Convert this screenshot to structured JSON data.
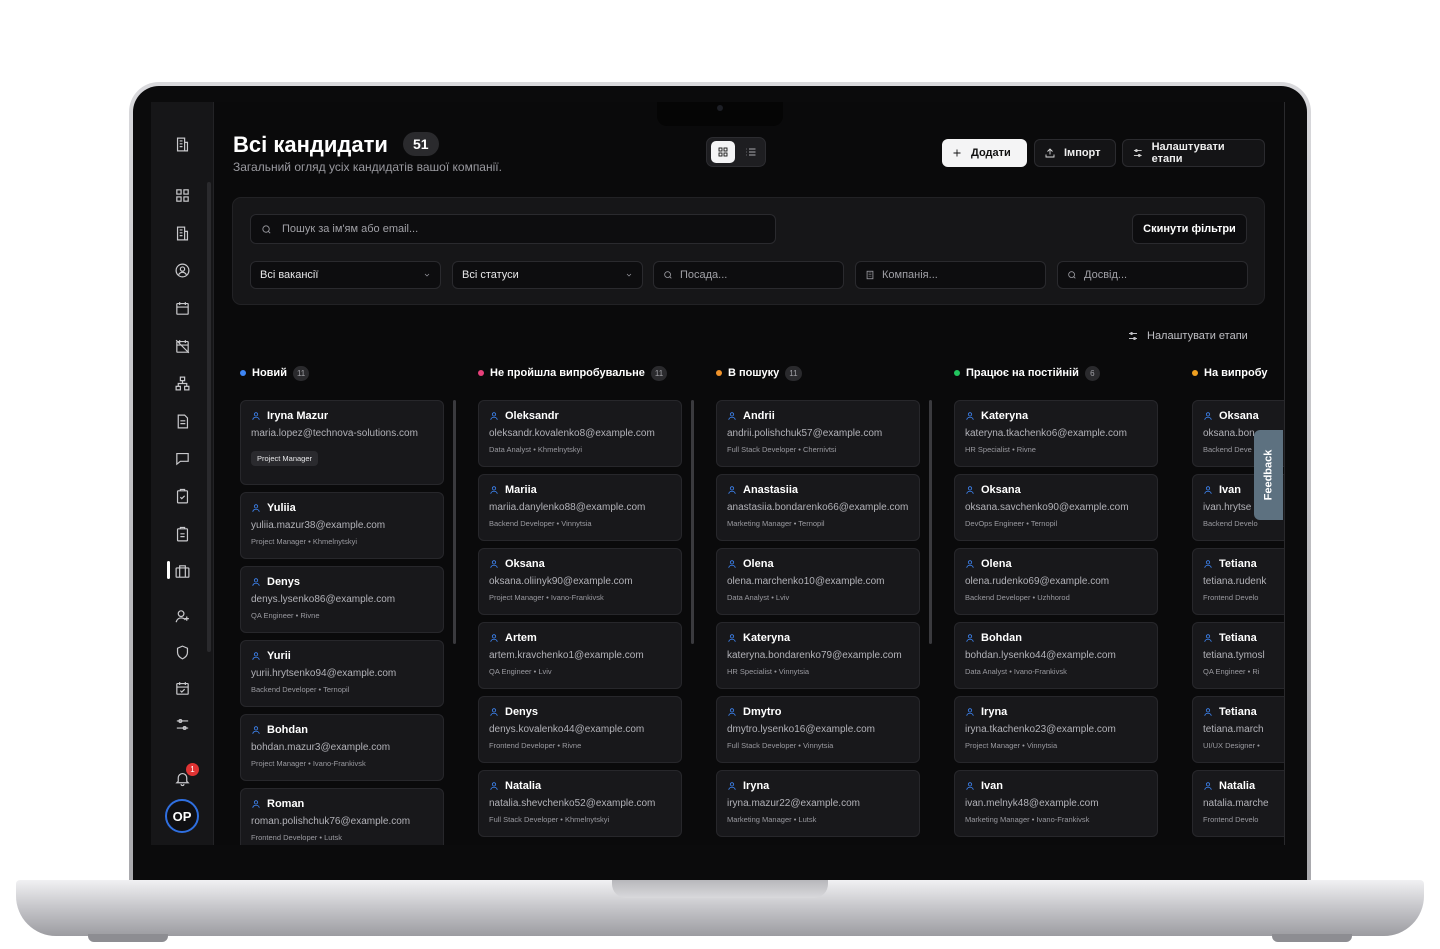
{
  "page": {
    "title": "Всі кандидати",
    "count": "51",
    "subtitle": "Загальний огляд усіх кандидатів вашої компанії."
  },
  "header_buttons": {
    "add": "Додати",
    "import": "Імпорт",
    "stages": "Налаштувати етапи"
  },
  "filters": {
    "search_placeholder": "Пошук за ім'ям або email...",
    "reset": "Скинути фільтри",
    "vacancies": "Всі вакансії",
    "statuses": "Всі статуси",
    "position_placeholder": "Посада...",
    "company_placeholder": "Компанія...",
    "experience_placeholder": "Досвід..."
  },
  "stages_link": "Налаштувати етапи",
  "notifications": {
    "badge": "1"
  },
  "user": {
    "initials": "OP"
  },
  "feedback": "Feedback",
  "colors": {
    "new": "#3e86f5",
    "failed": "#e8407a",
    "searching": "#f0932b",
    "employed": "#22c55e",
    "trial": "#f0a020"
  },
  "columns": [
    {
      "title": "Новий",
      "count": "11",
      "cards": [
        {
          "name": "Iryna Mazur",
          "email": "maria.lopez@technova-solutions.com",
          "tag": "Project Manager"
        },
        {
          "name": "Yuliia",
          "email": "yuliia.mazur38@example.com",
          "meta": "Project Manager • Khmelnytskyi"
        },
        {
          "name": "Denys",
          "email": "denys.lysenko86@example.com",
          "meta": "QA Engineer • Rivne"
        },
        {
          "name": "Yurii",
          "email": "yurii.hrytsenko94@example.com",
          "meta": "Backend Developer • Ternopil"
        },
        {
          "name": "Bohdan",
          "email": "bohdan.mazur3@example.com",
          "meta": "Project Manager • Ivano-Frankivsk"
        },
        {
          "name": "Roman",
          "email": "roman.polishchuk76@example.com",
          "meta": "Frontend Developer • Lutsk"
        }
      ]
    },
    {
      "title": "Не пройшла випробувальне",
      "count": "11",
      "cards": [
        {
          "name": "Oleksandr",
          "email": "oleksandr.kovalenko8@example.com",
          "meta": "Data Analyst • Khmelnytskyi"
        },
        {
          "name": "Mariia",
          "email": "mariia.danylenko88@example.com",
          "meta": "Backend Developer • Vinnytsia"
        },
        {
          "name": "Oksana",
          "email": "oksana.oliinyk90@example.com",
          "meta": "Project Manager • Ivano-Frankivsk"
        },
        {
          "name": "Artem",
          "email": "artem.kravchenko1@example.com",
          "meta": "QA Engineer • Lviv"
        },
        {
          "name": "Denys",
          "email": "denys.kovalenko44@example.com",
          "meta": "Frontend Developer • Rivne"
        },
        {
          "name": "Natalia",
          "email": "natalia.shevchenko52@example.com",
          "meta": "Full Stack Developer • Khmelnytskyi"
        }
      ]
    },
    {
      "title": "В пошуку",
      "count": "11",
      "cards": [
        {
          "name": "Andrii",
          "email": "andrii.polishchuk57@example.com",
          "meta": "Full Stack Developer • Chernivtsi"
        },
        {
          "name": "Anastasiia",
          "email": "anastasiia.bondarenko66@example.com",
          "meta": "Marketing Manager • Ternopil"
        },
        {
          "name": "Olena",
          "email": "olena.marchenko10@example.com",
          "meta": "Data Analyst • Lviv"
        },
        {
          "name": "Kateryna",
          "email": "kateryna.bondarenko79@example.com",
          "meta": "HR Specialist • Vinnytsia"
        },
        {
          "name": "Dmytro",
          "email": "dmytro.lysenko16@example.com",
          "meta": "Full Stack Developer • Vinnytsia"
        },
        {
          "name": "Iryna",
          "email": "iryna.mazur22@example.com",
          "meta": "Marketing Manager • Lutsk"
        }
      ]
    },
    {
      "title": "Працює на постійній",
      "count": "6",
      "cards": [
        {
          "name": "Kateryna",
          "email": "kateryna.tkachenko6@example.com",
          "meta": "HR Specialist • Rivne"
        },
        {
          "name": "Oksana",
          "email": "oksana.savchenko90@example.com",
          "meta": "DevOps Engineer • Ternopil"
        },
        {
          "name": "Olena",
          "email": "olena.rudenko69@example.com",
          "meta": "Backend Developer • Uzhhorod"
        },
        {
          "name": "Bohdan",
          "email": "bohdan.lysenko44@example.com",
          "meta": "Data Analyst • Ivano-Frankivsk"
        },
        {
          "name": "Iryna",
          "email": "iryna.tkachenko23@example.com",
          "meta": "Project Manager • Vinnytsia"
        },
        {
          "name": "Ivan",
          "email": "ivan.melnyk48@example.com",
          "meta": "Marketing Manager • Ivano-Frankivsk"
        }
      ]
    },
    {
      "title": "На випробу",
      "cards": [
        {
          "name": "Oksana",
          "email": "oksana.bon",
          "meta": "Backend Deve"
        },
        {
          "name": "Ivan",
          "email": "ivan.hrytse",
          "meta": "Backend Develo"
        },
        {
          "name": "Tetiana",
          "email": "tetiana.rudenk",
          "meta": "Frontend Develo"
        },
        {
          "name": "Tetiana",
          "email": "tetiana.tymosl",
          "meta": "QA Engineer • Ri"
        },
        {
          "name": "Tetiana",
          "email": "tetiana.march",
          "meta": "UI/UX Designer •"
        },
        {
          "name": "Natalia",
          "email": "natalia.marche",
          "meta": "Frontend Develo"
        }
      ]
    }
  ]
}
